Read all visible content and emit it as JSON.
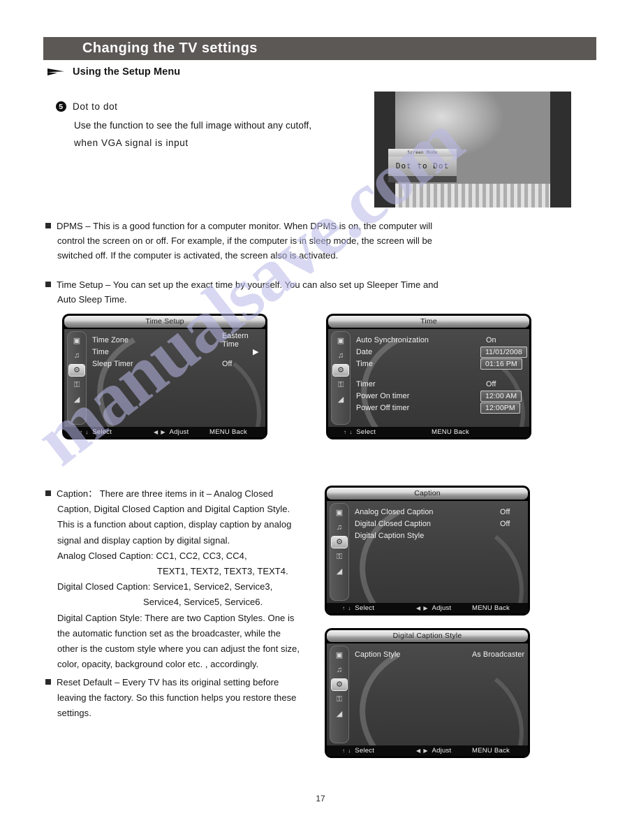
{
  "watermark": {
    "text": "manualsave.com"
  },
  "header": {
    "chapter_title": "Changing the TV settings"
  },
  "section": {
    "label": "Using the Setup Menu"
  },
  "item5": {
    "number": "5",
    "title": "Dot to dot",
    "line1": "Use the function to see the full image without any cutoff,",
    "line2": "when  VGA  signal  is  input"
  },
  "tv_photo": {
    "osd_popup_title": "Screen Mode",
    "osd_popup_value": "Dot to Dot"
  },
  "paragraphs": {
    "dpms": {
      "line1": "DPMS – This is a good function for a computer monitor.  When DPMS is on,  the computer will",
      "line2": "control the screen on or off.  For example,  if the computer is in sleep mode,  the screen will be",
      "line3": "switched off.  If the computer is activated,  the screen also is activated."
    },
    "time_setup": {
      "line1": "Time Setup – You can set up the exact time by yourself.  You can also set up Sleeper Time and",
      "line2": "Auto Sleep Time."
    },
    "caption": {
      "line1": "Caption： There are three items in it – Analog Closed",
      "line2": "Caption,  Digital Closed Caption and Digital Caption Style.",
      "line3": "This is a function about caption, display caption by analog",
      "line4": "signal and display caption by digital signal.",
      "line5": "Analog Closed Caption: CC1,  CC2,  CC3,  CC4,",
      "line6": "TEXT1, TEXT2, TEXT3, TEXT4.",
      "line7": "Digital Closed Caption: Service1,  Service2,  Service3,",
      "line8": "Service4,  Service5,  Service6.",
      "line9": "Digital Caption Style: There are two Caption Styles.  One is",
      "line10": "the automatic function set as the broadcaster,  while the",
      "line11": "other is the custom style where you can adjust the font size,",
      "line12": "color,  opacity,  background color etc. ,  accordingly."
    },
    "reset_default": {
      "line1": "Reset Default –  Every TV has its original setting before",
      "line2": "leaving the factory.  So this function helps you restore these",
      "line3": "settings."
    }
  },
  "osd_menus": {
    "time_setup": {
      "title": "Time Setup",
      "rows": [
        {
          "key": "Time Zone",
          "value": "Eastern Time",
          "kind": "plain"
        },
        {
          "key": "Time",
          "value": "▶",
          "kind": "caret"
        },
        {
          "key": "Sleep Timer",
          "value": "Off",
          "kind": "plain"
        }
      ],
      "footer": {
        "select": "Select",
        "adjust": "Adjust",
        "back": "MENU  Back",
        "select_keys": "↑ ↓",
        "adjust_keys": "◀ ▶"
      }
    },
    "time": {
      "title": "Time",
      "rows": [
        {
          "key": "Auto Synchronization",
          "value": "On",
          "kind": "plain"
        },
        {
          "key": "Date",
          "value": "11/01/2008",
          "kind": "box"
        },
        {
          "key": "Time",
          "value": "01:16 PM",
          "kind": "box"
        },
        {
          "key": "",
          "value": "",
          "kind": "gap"
        },
        {
          "key": "Timer",
          "value": "Off",
          "kind": "plain"
        },
        {
          "key": "Power On timer",
          "value": "12:00 AM",
          "kind": "box"
        },
        {
          "key": "Power Off timer",
          "value": "12:00PM",
          "kind": "box"
        }
      ],
      "footer": {
        "select": "Select",
        "adjust": "",
        "back": "MENU  Back",
        "select_keys": "↑ ↓",
        "adjust_keys": ""
      }
    },
    "caption": {
      "title": "Caption",
      "rows": [
        {
          "key": "Analog Closed Caption",
          "value": "Off",
          "kind": "plain"
        },
        {
          "key": "Digital Closed Caption",
          "value": "Off",
          "kind": "plain"
        },
        {
          "key": "Digital Caption Style",
          "value": "▶",
          "kind": "caret"
        }
      ],
      "footer": {
        "select": "Select",
        "adjust": "Adjust",
        "back": "MENU  Back",
        "select_keys": "↑ ↓",
        "adjust_keys": "◀ ▶"
      }
    },
    "digital_caption_style": {
      "title": "Digital Caption Style",
      "rows": [
        {
          "key": "Caption Style",
          "value": "As Broadcaster",
          "kind": "plain"
        }
      ],
      "footer": {
        "select": "Select",
        "adjust": "Adjust",
        "back": "MENU  Back",
        "select_keys": "↑ ↓",
        "adjust_keys": "◀ ▶"
      }
    },
    "sidebar_icons": [
      {
        "name": "picture-icon",
        "glyph": "▣",
        "selected": false
      },
      {
        "name": "audio-icon",
        "glyph": "♫",
        "selected": false
      },
      {
        "name": "setup-icon",
        "glyph": "⚙",
        "selected": true
      },
      {
        "name": "lock-icon",
        "glyph": "⚿",
        "selected": false
      },
      {
        "name": "antenna-icon",
        "glyph": "◢",
        "selected": false
      }
    ]
  },
  "footer": {
    "page_number": "17"
  },
  "colors": {
    "chapter_bar": "#5c5856",
    "osd_body": "#3e3e3e",
    "osd_title_bar": "#d8d8d8",
    "watermark": "#b9b9e8",
    "text": "#151515"
  }
}
